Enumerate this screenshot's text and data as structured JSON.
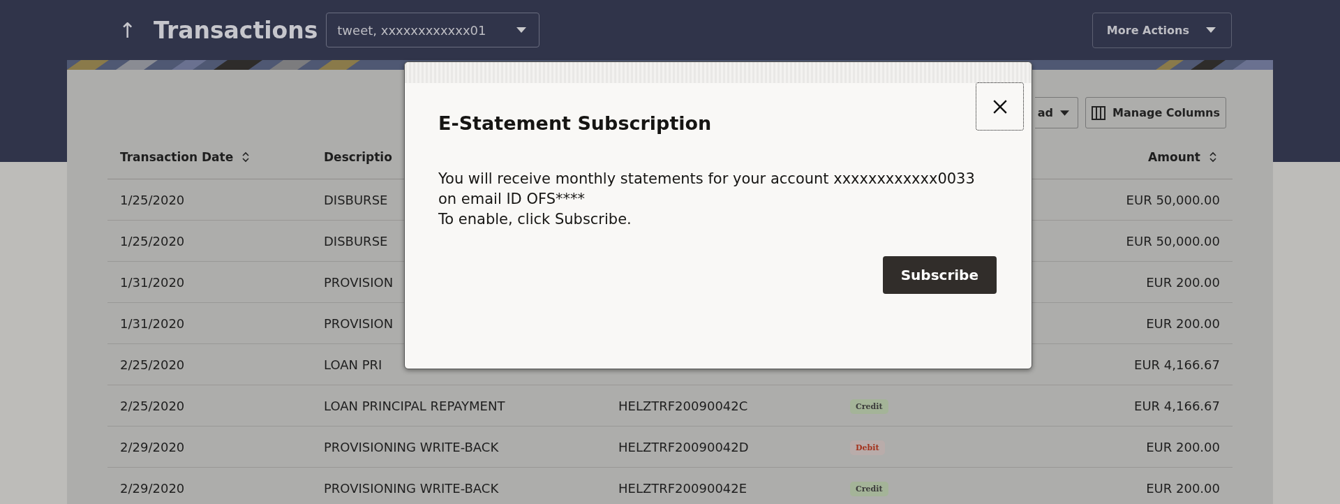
{
  "header": {
    "back": "↑",
    "title": "Transactions",
    "account": "tweet, xxxxxxxxxxxx01",
    "more_actions": "More Actions"
  },
  "toolbar": {
    "download": "ad",
    "manage_columns": "Manage Columns"
  },
  "table": {
    "columns": [
      {
        "label": "Transaction Date",
        "sortable": true
      },
      {
        "label": "Descriptio",
        "sortable": false
      },
      {
        "label": "Amount",
        "sortable": true
      }
    ],
    "rows": [
      {
        "date": "1/25/2020",
        "description": "DISBURSE",
        "amount": "EUR 50,000.00"
      },
      {
        "date": "1/25/2020",
        "description": "DISBURSE",
        "amount": "EUR 50,000.00"
      },
      {
        "date": "1/31/2020",
        "description": "PROVISION",
        "amount": "EUR 200.00"
      },
      {
        "date": "1/31/2020",
        "description": "PROVISION",
        "amount": "EUR 200.00"
      },
      {
        "date": "2/25/2020",
        "description": "LOAN PRI",
        "amount": "EUR 4,166.67"
      },
      {
        "date": "2/25/2020",
        "description": "LOAN PRINCIPAL REPAYMENT",
        "reference": "HELZTRF20090042C",
        "type": {
          "kind": "credit",
          "label": "Credit"
        },
        "amount": "EUR 4,166.67"
      },
      {
        "date": "2/29/2020",
        "description": "PROVISIONING WRITE-BACK",
        "reference": "HELZTRF20090042D",
        "type": {
          "kind": "debit",
          "label": "Debit"
        },
        "amount": "EUR 200.00"
      },
      {
        "date": "2/29/2020",
        "description": "PROVISIONING WRITE-BACK",
        "reference": "HELZTRF20090042E",
        "type": {
          "kind": "credit",
          "label": "Credit"
        },
        "amount": "EUR 200.00"
      }
    ]
  },
  "modal": {
    "title": "E-Statement Subscription",
    "lines": [
      "You will receive monthly statements for your account xxxxxxxxxxxx0033",
      "on email ID OFS****",
      "To enable, click Subscribe."
    ],
    "subscribe": "Subscribe"
  }
}
